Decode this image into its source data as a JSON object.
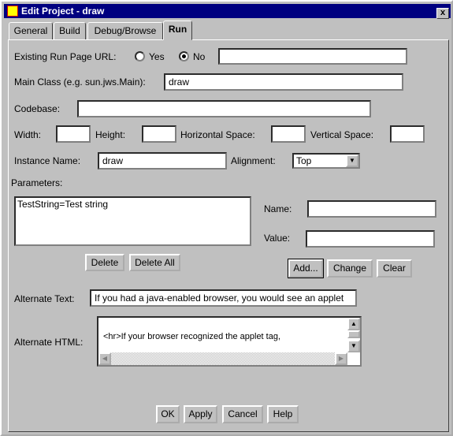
{
  "window": {
    "title": "Edit Project - draw",
    "close": "x"
  },
  "tabs": [
    {
      "label": "General"
    },
    {
      "label": "Build"
    },
    {
      "label": "Debug/Browse"
    },
    {
      "label": "Run",
      "selected": true
    }
  ],
  "run": {
    "existing_url_label": "Existing Run Page URL:",
    "yes": "Yes",
    "no": "No",
    "selected": "No",
    "existing_url_value": "",
    "main_class_label": "Main Class (e.g. sun.jws.Main):",
    "main_class_value": "draw",
    "codebase_label": "Codebase:",
    "codebase_value": "",
    "width_label": "Width:",
    "width_value": "",
    "height_label": "Height:",
    "height_value": "",
    "hspace_label": "Horizontal Space:",
    "hspace_value": "",
    "vspace_label": "Vertical Space:",
    "vspace_value": "",
    "instance_label": "Instance Name:",
    "instance_value": "draw",
    "alignment_label": "Alignment:",
    "alignment_value": "Top",
    "parameters_label": "Parameters:",
    "parameters": [
      "TestString=Test string"
    ],
    "delete": "Delete",
    "delete_all": "Delete All",
    "name_label": "Name:",
    "name_value": "",
    "value_label": "Value:",
    "value_value": "",
    "add": "Add...",
    "change": "Change",
    "clear": "Clear",
    "alt_text_label": "Alternate Text:",
    "alt_text_value": "If you had a java-enabled browser, you would see an applet",
    "alt_html_label": "Alternate HTML:",
    "alt_html_value": "<hr>If your browser recognized the applet tag,"
  },
  "footer": {
    "ok": "OK",
    "apply": "Apply",
    "cancel": "Cancel",
    "help": "Help"
  },
  "colors": {
    "titlebar": "#000080",
    "face": "#c0c0c0"
  }
}
